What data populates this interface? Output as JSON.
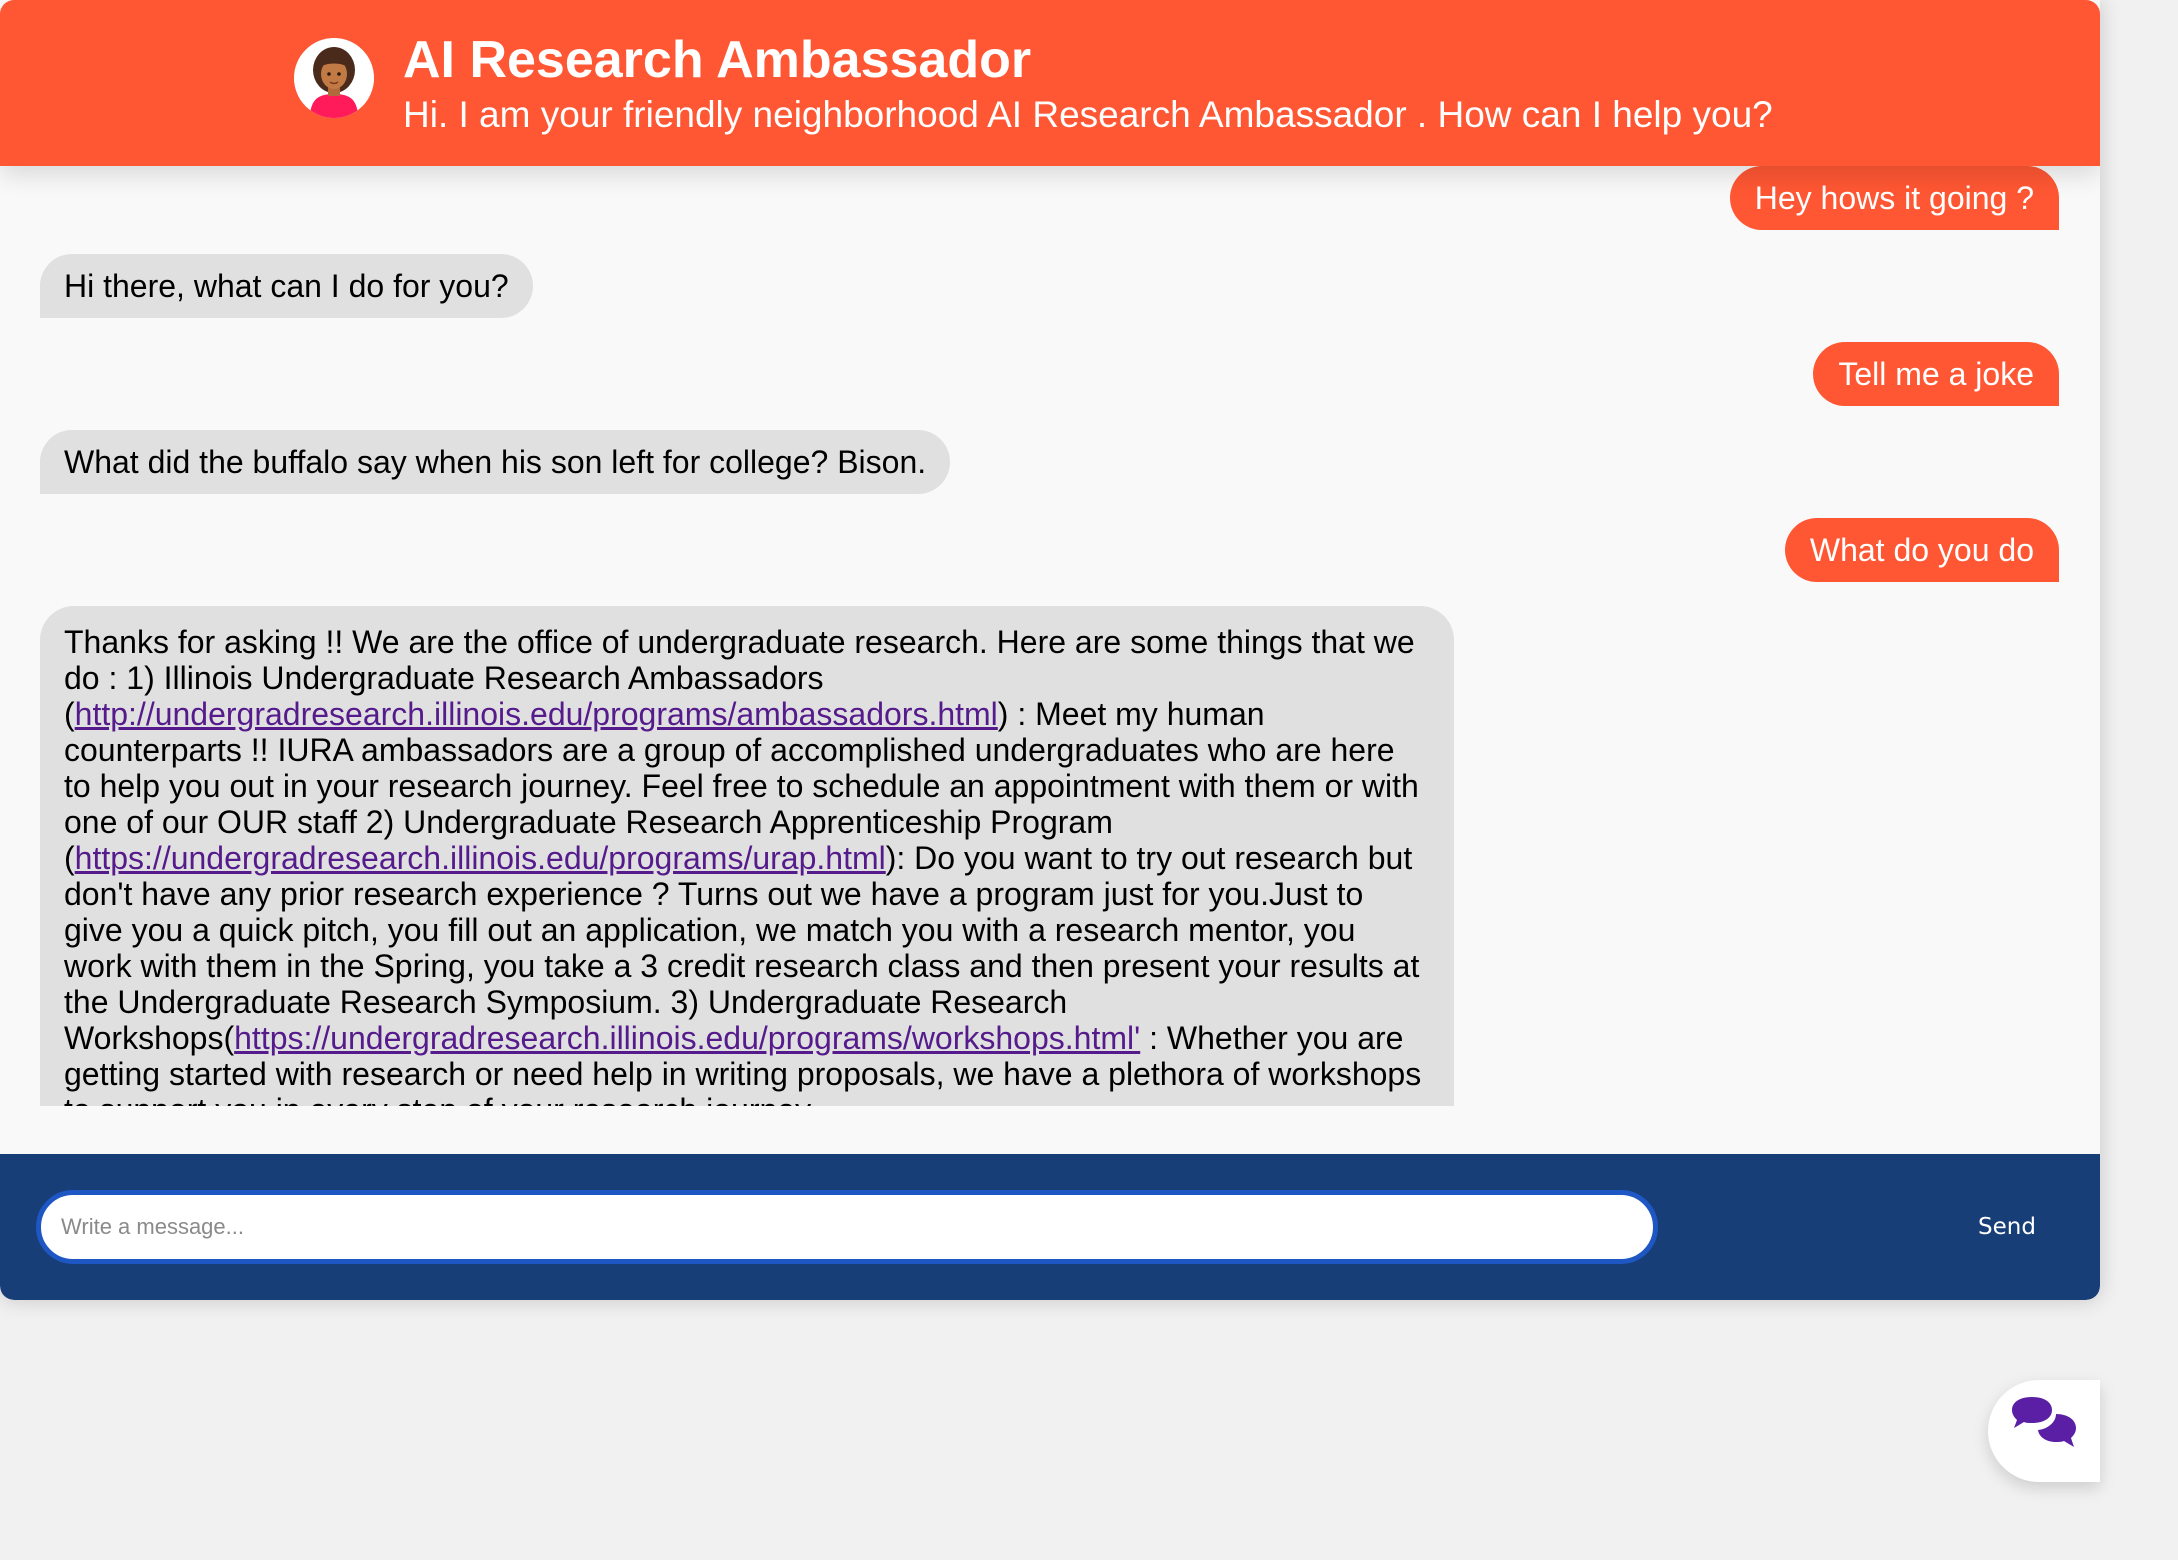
{
  "header": {
    "title": "AI Research Ambassador",
    "subtitle": "Hi. I am your friendly neighborhood AI Research Ambassador . How can I help you?",
    "avatar_icon": "woman-avatar-icon"
  },
  "messages": [
    {
      "sender": "user",
      "text": "Hey hows it going ?"
    },
    {
      "sender": "bot",
      "text": "Hi there, what can I do for you?"
    },
    {
      "sender": "user",
      "text": "Tell me a joke"
    },
    {
      "sender": "bot",
      "text": "What did the buffalo say when his son left for college? Bison."
    },
    {
      "sender": "user",
      "text": "What do you do"
    },
    {
      "sender": "bot",
      "parts": {
        "p1": "Thanks for asking !! We are the office of undergraduate research. Here are some things that we do : 1) Illinois Undergraduate Research Ambassadors (",
        "link1": "http://undergradresearch.illinois.edu/programs/ambassadors.html",
        "p2": ") : Meet my human counterparts !! IURA ambassadors are a group of accomplished undergraduates who are here to help you out in your research journey. Feel free to schedule an appointment with them or with one of our OUR staff 2) Undergraduate Research Apprenticeship Program (",
        "link2": "https://undergradresearch.illinois.edu/programs/urap.html",
        "p3": "): Do you want to try out research but don't have any prior research experience ? Turns out we have a program just for you.Just to give you a quick pitch, you fill out an application, we match you with a research mentor, you work with them in the Spring, you take a 3 credit research class and then present your results at the Undergraduate Research Symposium. 3) Undergraduate Research Workshops(",
        "link3": "https://undergradresearch.illinois.edu/programs/workshops.html'",
        "p4": " : Whether you are getting started with research or need help in writing proposals, we have a plethora of workshops to support you in every step of your research journey"
      }
    }
  ],
  "footer": {
    "input_placeholder": "Write a message...",
    "input_value": "",
    "send_label": "Send"
  },
  "launcher": {
    "icon": "chat-bubbles-icon"
  },
  "colors": {
    "header_bg": "#ff5733",
    "user_bubble": "#ff5733",
    "bot_bubble": "#e0e0e0",
    "footer_bg": "#183e78",
    "input_border": "#1e56c4",
    "launcher_icon": "#5b1fa6",
    "link": "#551a8b"
  }
}
